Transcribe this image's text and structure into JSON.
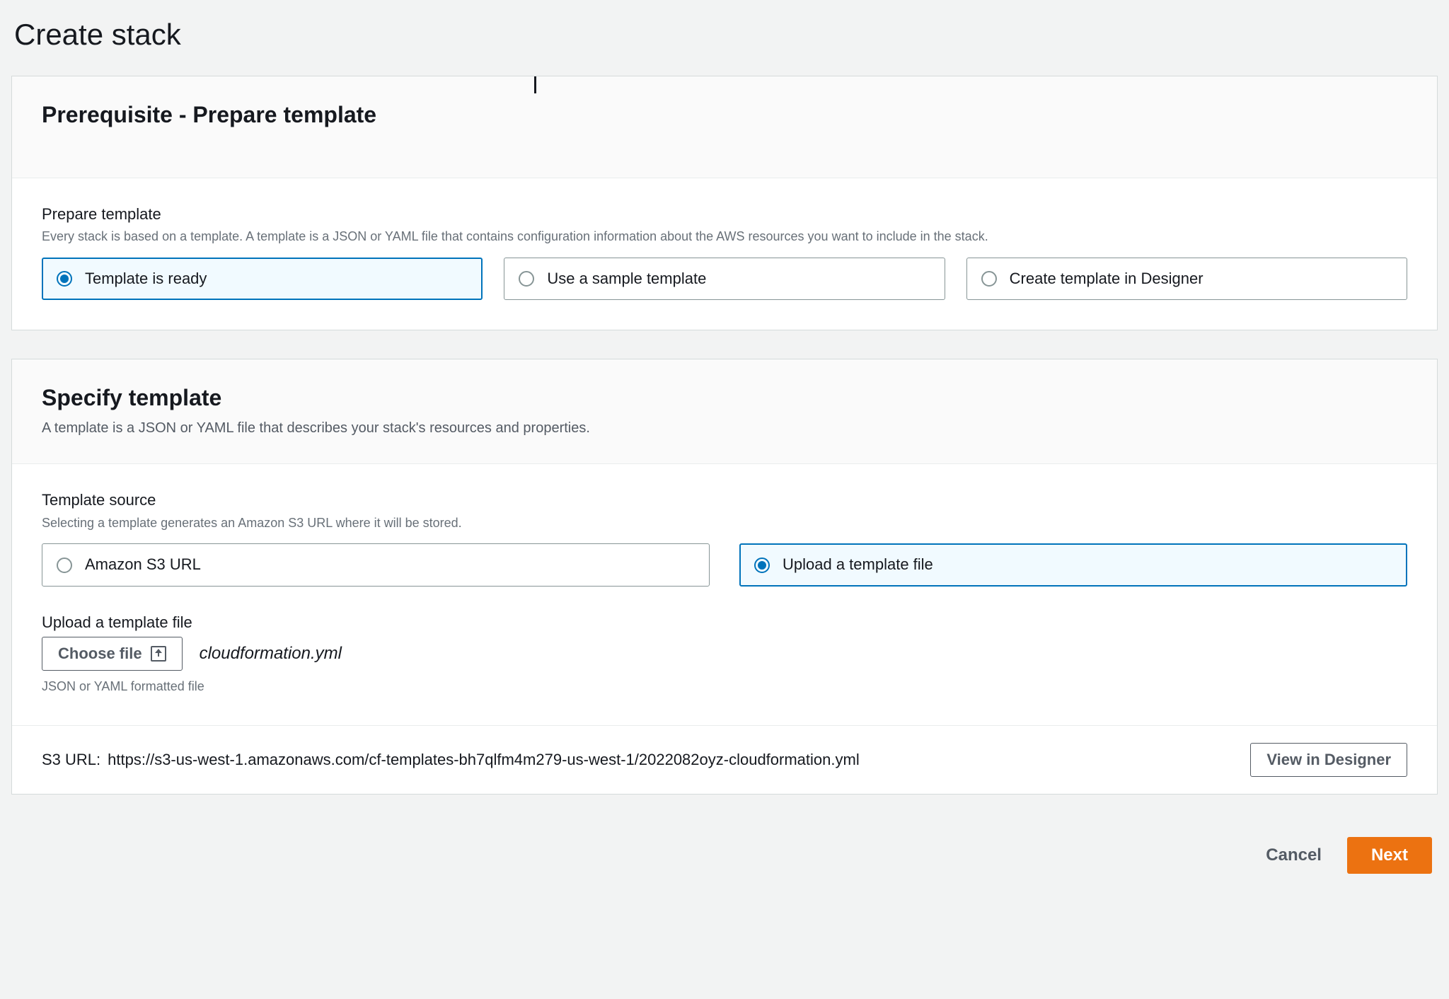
{
  "page": {
    "title": "Create stack"
  },
  "prerequisite": {
    "heading": "Prerequisite - Prepare template",
    "field_label": "Prepare template",
    "field_hint": "Every stack is based on a template. A template is a JSON or YAML file that contains configuration information about the AWS resources you want to include in the stack.",
    "options": [
      {
        "label": "Template is ready",
        "selected": true
      },
      {
        "label": "Use a sample template",
        "selected": false
      },
      {
        "label": "Create template in Designer",
        "selected": false
      }
    ]
  },
  "specify": {
    "heading": "Specify template",
    "description": "A template is a JSON or YAML file that describes your stack's resources and properties.",
    "source_label": "Template source",
    "source_hint": "Selecting a template generates an Amazon S3 URL where it will be stored.",
    "source_options": [
      {
        "label": "Amazon S3 URL",
        "selected": false
      },
      {
        "label": "Upload a template file",
        "selected": true
      }
    ],
    "upload_label": "Upload a template file",
    "choose_file_label": "Choose file",
    "uploaded_filename": "cloudformation.yml",
    "file_hint": "JSON or YAML formatted file",
    "s3_url_label": "S3 URL:",
    "s3_url_value": "https://s3-us-west-1.amazonaws.com/cf-templates-bh7qlfm4m279-us-west-1/2022082oyz-cloudformation.yml",
    "view_designer_label": "View in Designer"
  },
  "actions": {
    "cancel": "Cancel",
    "next": "Next"
  }
}
